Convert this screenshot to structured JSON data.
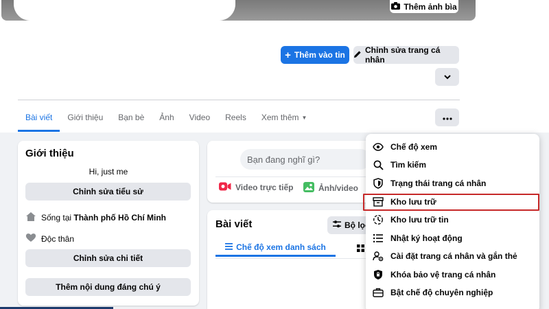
{
  "cover": {
    "add_cover_label": "Thêm ảnh bìa"
  },
  "actions": {
    "add_story_label": "Thêm vào tin",
    "edit_profile_label": "Chỉnh sửa trang cá nhân"
  },
  "tabs": [
    {
      "label": "Bài viết",
      "active": true
    },
    {
      "label": "Giới thiệu"
    },
    {
      "label": "Bạn bè"
    },
    {
      "label": "Ảnh"
    },
    {
      "label": "Video"
    },
    {
      "label": "Reels"
    },
    {
      "label": "Xem thêm"
    }
  ],
  "intro": {
    "title": "Giới thiệu",
    "bio": "Hi, just me",
    "edit_bio_label": "Chỉnh sửa tiểu sử",
    "lives_prefix": "Sống tại ",
    "lives_city": "Thành phố Hồ Chí Minh",
    "relationship": "Độc thân",
    "edit_details_label": "Chỉnh sửa chi tiết",
    "add_featured_label": "Thêm nội dung đáng chú ý"
  },
  "composer": {
    "placeholder": "Bạn đang nghĩ gì?",
    "live_label": "Video trực tiếp",
    "photo_label": "Ảnh/video"
  },
  "posts": {
    "title": "Bài viết",
    "filter_label": "Bộ lọc",
    "list_view_label": "Chế độ xem danh sách"
  },
  "menu": [
    {
      "label": "Chế độ xem",
      "icon": "eye-icon"
    },
    {
      "label": "Tìm kiếm",
      "icon": "search-icon"
    },
    {
      "label": "Trạng thái trang cá nhân",
      "icon": "shield-icon"
    },
    {
      "label": "Kho lưu trữ",
      "icon": "archive-icon"
    },
    {
      "label": "Kho lưu trữ tin",
      "icon": "story-archive-icon"
    },
    {
      "label": "Nhật ký hoạt động",
      "icon": "list-icon"
    },
    {
      "label": "Cài đặt trang cá nhân và gắn thẻ",
      "icon": "profile-settings-icon"
    },
    {
      "label": "Khóa bảo vệ trang cá nhân",
      "icon": "lock-shield-icon"
    },
    {
      "label": "Bật chế độ chuyên nghiệp",
      "icon": "briefcase-icon"
    }
  ],
  "colors": {
    "accent": "#1b74e4",
    "highlight": "#c62828",
    "live": "#f02849",
    "photo": "#45bd62"
  }
}
